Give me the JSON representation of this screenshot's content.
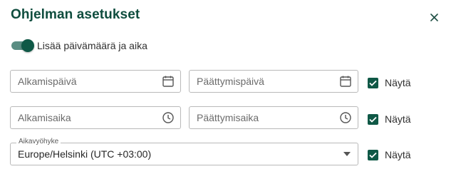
{
  "dialog": {
    "title": "Ohjelman asetukset",
    "close_icon": "close-icon"
  },
  "toggle": {
    "label": "Lisää päivämäärä ja aika",
    "checked": true
  },
  "fields": {
    "start_date": {
      "placeholder": "Alkamispäivä",
      "icon": "calendar-icon"
    },
    "end_date": {
      "placeholder": "Päättymispäivä",
      "icon": "calendar-icon"
    },
    "start_time": {
      "placeholder": "Alkamisaika",
      "icon": "clock-icon"
    },
    "end_time": {
      "placeholder": "Päättymisaika",
      "icon": "clock-icon"
    }
  },
  "timezone": {
    "label": "Aikavyöhyke",
    "value": "Europe/Helsinki (UTC +03:00)",
    "icon": "caret-down-icon"
  },
  "show_checkboxes": [
    {
      "label": "Näytä",
      "checked": true
    },
    {
      "label": "Näytä",
      "checked": true
    },
    {
      "label": "Näytä",
      "checked": true
    }
  ],
  "colors": {
    "accent": "#0f5846",
    "title": "#0f4d3e",
    "toggle_track": "#5a8d83",
    "border": "#b9b9b9"
  }
}
